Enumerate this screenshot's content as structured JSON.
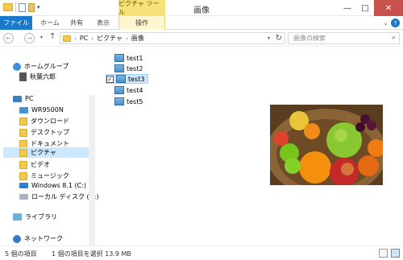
{
  "window": {
    "title": "画像"
  },
  "ribbon": {
    "file_tab": "ファイル",
    "tabs": [
      "ホーム",
      "共有",
      "表示"
    ],
    "context_group": "ピクチャ ツール",
    "manage_tab": "操作"
  },
  "address": {
    "crumbs": [
      "PC",
      "ピクチャ",
      "画像"
    ],
    "search_placeholder": "画像の検索"
  },
  "sidebar": {
    "items": [
      {
        "label": "ホームグループ",
        "icon": "homegroup-icon"
      },
      {
        "label": "秋葉六郎",
        "icon": "user-icon"
      },
      {
        "label": "PC",
        "icon": "pc-icon"
      },
      {
        "label": "WR9500N",
        "icon": "network-device-icon"
      },
      {
        "label": "ダウンロード",
        "icon": "downloads-folder-icon"
      },
      {
        "label": "デスクトップ",
        "icon": "desktop-folder-icon"
      },
      {
        "label": "ドキュメント",
        "icon": "documents-folder-icon"
      },
      {
        "label": "ピクチャ",
        "icon": "pictures-folder-icon"
      },
      {
        "label": "ビデオ",
        "icon": "videos-folder-icon"
      },
      {
        "label": "ミュージック",
        "icon": "music-folder-icon"
      },
      {
        "label": "Windows 8.1 (C:)",
        "icon": "windows-drive-icon"
      },
      {
        "label": "ローカル ディスク (D:)",
        "icon": "local-disk-icon"
      },
      {
        "label": "ライブラリ",
        "icon": "libraries-icon"
      },
      {
        "label": "ネットワーク",
        "icon": "network-icon"
      }
    ]
  },
  "files": [
    {
      "name": "test1",
      "selected": false
    },
    {
      "name": "test2",
      "selected": false
    },
    {
      "name": "test3",
      "selected": true
    },
    {
      "name": "test4",
      "selected": false
    },
    {
      "name": "test5",
      "selected": false
    }
  ],
  "status": {
    "item_count": "5 個の項目",
    "selection": "1 個の項目を選択  13.9 MB"
  }
}
